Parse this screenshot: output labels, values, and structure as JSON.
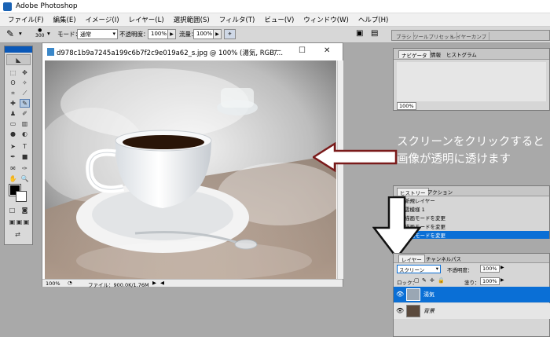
{
  "app": {
    "title": "Adobe Photoshop"
  },
  "menus": [
    "ファイル(F)",
    "編集(E)",
    "イメージ(I)",
    "レイヤー(L)",
    "選択範囲(S)",
    "フィルタ(T)",
    "ビュー(V)",
    "ウィンドウ(W)",
    "ヘルプ(H)"
  ],
  "options": {
    "brush_size": "300",
    "mode_label": "モード：",
    "mode_value": "通常",
    "opacity_label": "不透明度：",
    "opacity_value": "100%",
    "flow_label": "流量：",
    "flow_value": "100%"
  },
  "palette_well": {
    "tabs": [
      "ブラシ",
      "ツールプリセット",
      "レイヤーカンプ"
    ]
  },
  "document": {
    "title": "d978c1b9a7245a199c6b7f2c9e019a62_s.jpg @ 100% (湯気, RGB/...",
    "zoom": "100%",
    "file_info": "ファイル：900.0K/1.76M"
  },
  "navigator": {
    "tabs": [
      "ナビゲータ",
      "情報",
      "ヒストグラム"
    ],
    "zoom": "100%"
  },
  "history": {
    "tabs": [
      "ヒストリー",
      "アクション"
    ],
    "items": [
      "新規レイヤー",
      "雲模様 1",
      "描画モードを変更",
      "描画モードを変更",
      "描画モードを変更"
    ],
    "selected_index": 4
  },
  "layers": {
    "tabs": [
      "レイヤー",
      "チャンネル",
      "パス"
    ],
    "blend_mode": "スクリーン",
    "opacity_label": "不透明度：",
    "opacity_value": "100%",
    "lock_label": "ロック：",
    "fill_label": "塗り：",
    "fill_value": "100%",
    "items": [
      {
        "name": "湯気",
        "selected": true
      },
      {
        "name": "背景",
        "selected": false
      }
    ]
  },
  "annotation": {
    "line1": "スクリーンをクリックすると",
    "line2": "画像が透明に透けます"
  },
  "colors": {
    "accent": "#0a6fd6",
    "arrow": "#7a1a1a"
  }
}
